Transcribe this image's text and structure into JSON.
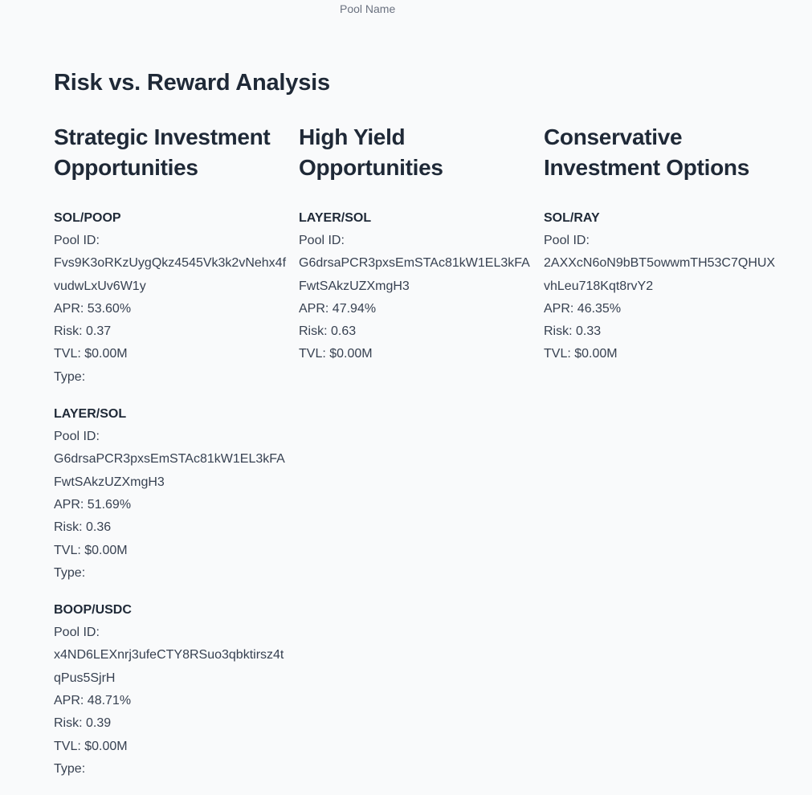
{
  "axis_caption": "Pool Name",
  "section_title": "Risk vs. Reward Analysis",
  "columns": [
    {
      "title": "Strategic Investment Opportunities",
      "pools": [
        {
          "name": "SOL/POOP",
          "pool_id_label": "Pool ID:",
          "pool_id": "Fvs9K3oRKzUygQkz4545Vk3k2vNehx4fvudwLxUv6W1y",
          "apr": "APR: 53.60%",
          "risk": "Risk: 0.37",
          "tvl": "TVL: $0.00M",
          "type": "Type:"
        },
        {
          "name": "LAYER/SOL",
          "pool_id_label": "Pool ID:",
          "pool_id": "G6drsaPCR3pxsEmSTAc81kW1EL3kFAFwtSAkzUZXmgH3",
          "apr": "APR: 51.69%",
          "risk": "Risk: 0.36",
          "tvl": "TVL: $0.00M",
          "type": "Type:"
        },
        {
          "name": "BOOP/USDC",
          "pool_id_label": "Pool ID:",
          "pool_id": "x4ND6LEXnrj3ufeCTY8RSuo3qbktirsz4tqPus5SjrH",
          "apr": "APR: 48.71%",
          "risk": "Risk: 0.39",
          "tvl": "TVL: $0.00M",
          "type": "Type:"
        }
      ]
    },
    {
      "title": "High Yield Opportunities",
      "pools": [
        {
          "name": "LAYER/SOL",
          "pool_id_label": "Pool ID:",
          "pool_id": "G6drsaPCR3pxsEmSTAc81kW1EL3kFAFwtSAkzUZXmgH3",
          "apr": "APR: 47.94%",
          "risk": "Risk: 0.63",
          "tvl": "TVL: $0.00M"
        }
      ]
    },
    {
      "title": "Conservative Investment Options",
      "pools": [
        {
          "name": "SOL/RAY",
          "pool_id_label": "Pool ID:",
          "pool_id": "2AXXcN6oN9bBT5owwmTH53C7QHUXvhLeu718Kqt8rvY2",
          "apr": "APR: 46.35%",
          "risk": "Risk: 0.33",
          "tvl": "TVL: $0.00M"
        }
      ]
    }
  ]
}
